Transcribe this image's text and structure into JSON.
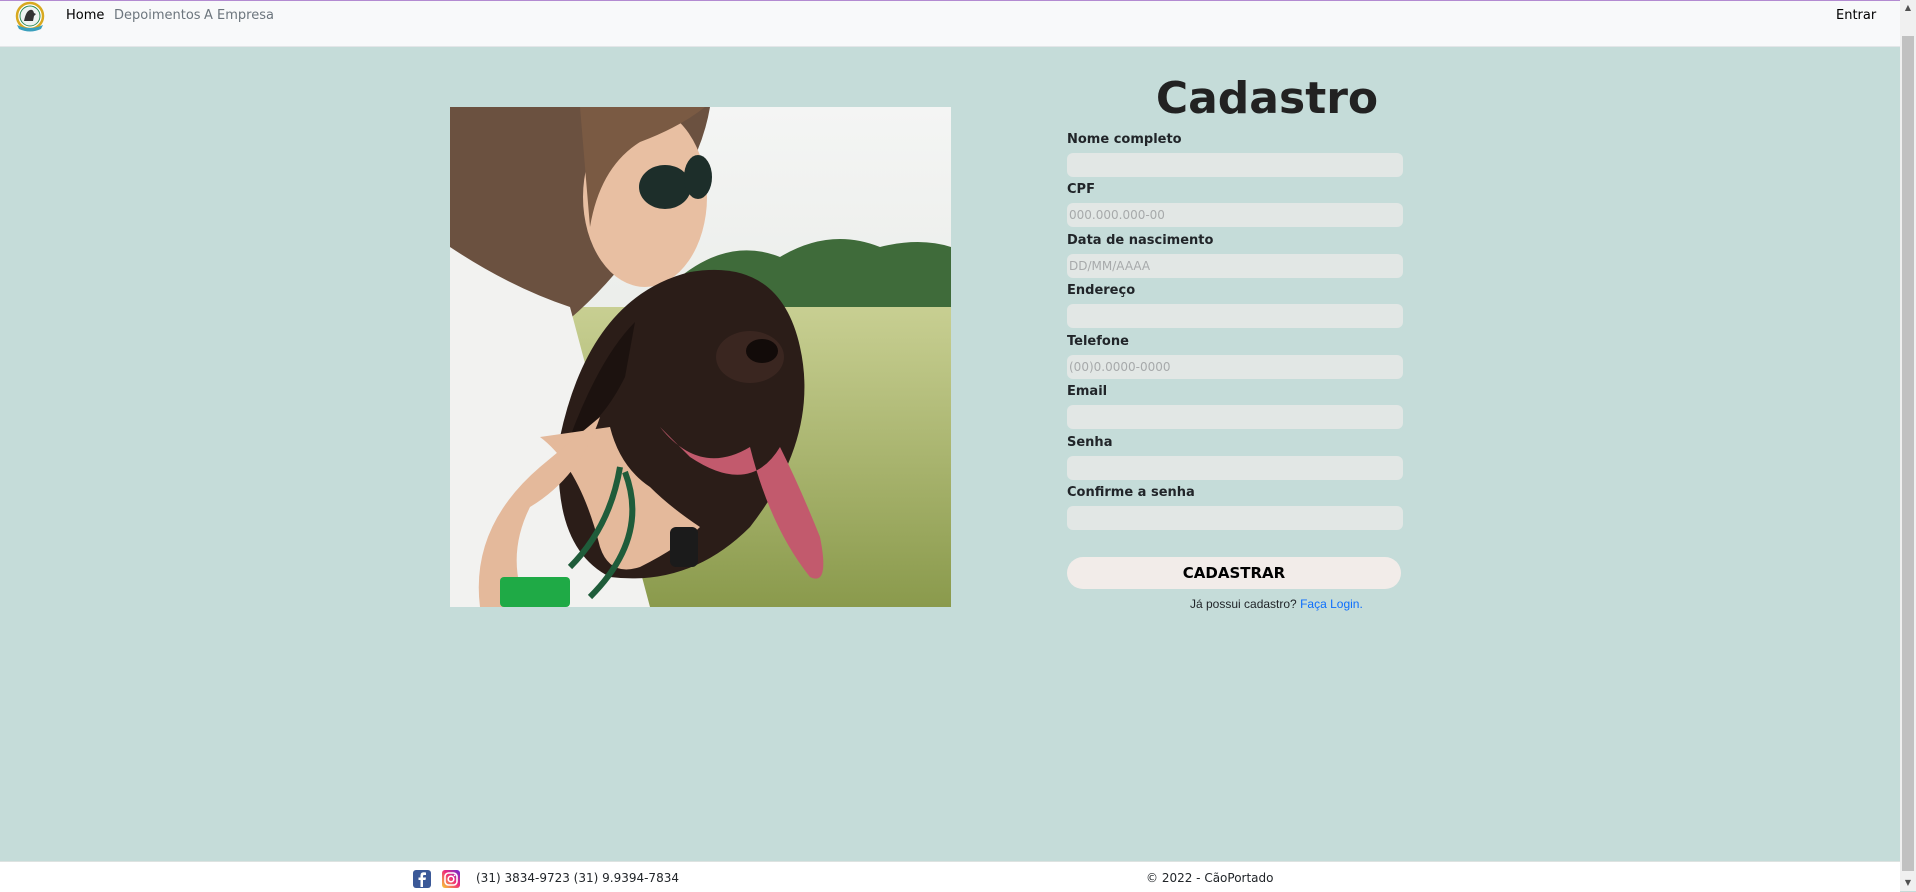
{
  "nav": {
    "logo_alt": "CãoPortado",
    "links": [
      "Home",
      "Depoimentos",
      "A Empresa"
    ],
    "login_label": "Entrar"
  },
  "form": {
    "title": "Cadastro",
    "fields": [
      {
        "label": "Nome completo",
        "placeholder": ""
      },
      {
        "label": "CPF",
        "placeholder": "000.000.000-00"
      },
      {
        "label": "Data de nascimento",
        "placeholder": "DD/MM/AAAA"
      },
      {
        "label": "Endereço",
        "placeholder": ""
      },
      {
        "label": "Telefone",
        "placeholder": "(00)0.0000-0000"
      },
      {
        "label": "Email",
        "placeholder": ""
      },
      {
        "label": "Senha",
        "placeholder": ""
      },
      {
        "label": "Confirme a senha",
        "placeholder": ""
      }
    ],
    "submit_label": "CADASTRAR",
    "login_prompt": "Já possui cadastro?",
    "login_link": "Faça Login."
  },
  "footer": {
    "phones": "(31) 3834-9723 (31) 9.9394-7834",
    "copyright": "© 2022 - CãoPortado"
  },
  "colors": {
    "page_bg": "#c5dcd9",
    "input_bg": "#e2e7e5",
    "button_bg": "#f2ece9",
    "link": "#0d6efd"
  }
}
